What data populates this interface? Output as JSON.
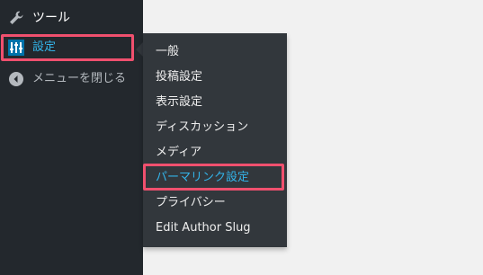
{
  "sidebar": {
    "tools_label": "ツール",
    "settings_label": "設定",
    "collapse_label": "メニューを閉じる"
  },
  "submenu": {
    "items": [
      "一般",
      "投稿設定",
      "表示設定",
      "ディスカッション",
      "メディア",
      "パーマリンク設定",
      "プライバシー",
      "Edit Author Slug"
    ]
  },
  "colors": {
    "sidebar_bg": "#23282d",
    "submenu_bg": "#32373c",
    "accent": "#33b3e8",
    "highlight_border": "#f0506e",
    "settings_icon_bg": "#0073aa"
  },
  "icons": [
    "wrench-icon",
    "settings-sliders-icon",
    "collapse-arrow-icon"
  ]
}
